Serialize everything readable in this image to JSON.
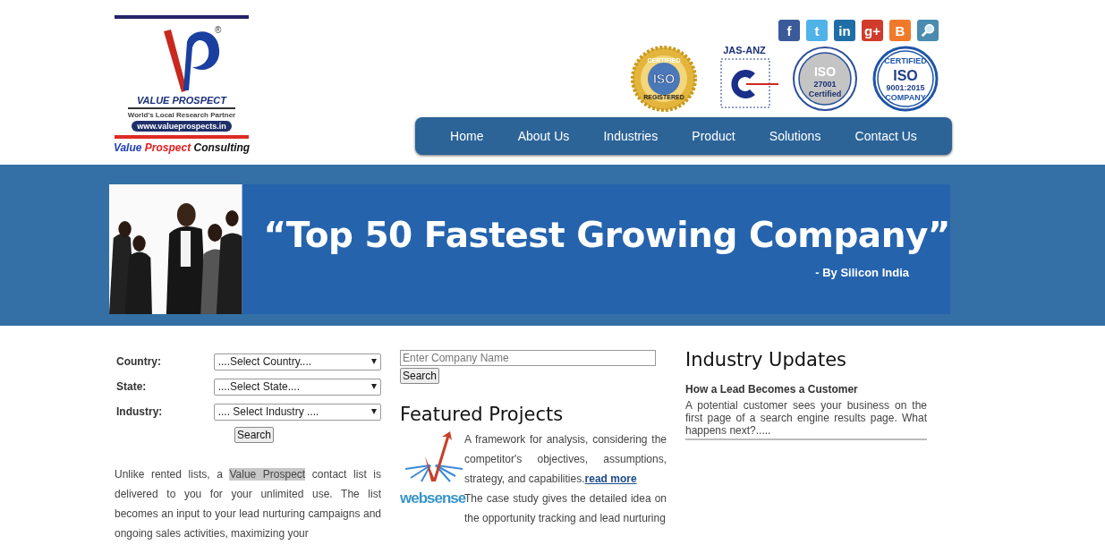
{
  "logo": {
    "registered": "®",
    "brand": "VALUE PROSPECT",
    "tagline": "World's Local Research Partner",
    "url": "www.valueprospects.in",
    "caption": [
      {
        "text": "Value",
        "color": "#1f3fb8"
      },
      {
        "text": "Prospect",
        "color": "#e02020"
      },
      {
        "text": "Consulting",
        "color": "#111111"
      }
    ]
  },
  "social_icons": [
    {
      "kind": "facebook",
      "glyph": "f"
    },
    {
      "kind": "twitter",
      "glyph": "t"
    },
    {
      "kind": "linkedin",
      "glyph": "in"
    },
    {
      "kind": "googleplus",
      "glyph": "g+"
    },
    {
      "kind": "blogger",
      "glyph": "B"
    },
    {
      "kind": "search"
    }
  ],
  "badges": [
    {
      "kind": "seal",
      "texts": [
        "CERTIFIED",
        "ISO",
        "REGISTERED"
      ]
    },
    {
      "kind": "jasanz",
      "texts": [
        "JAS-ANZ"
      ]
    },
    {
      "kind": "ring",
      "texts": [
        "ISO",
        "27001",
        "Certified"
      ]
    },
    {
      "kind": "stamp",
      "texts": [
        "CERTIFIED",
        "ISO",
        "9001:2015",
        "COMPANY"
      ]
    }
  ],
  "nav": [
    {
      "label": "Home"
    },
    {
      "label": "About Us"
    },
    {
      "label": "Industries"
    },
    {
      "label": "Product"
    },
    {
      "label": "Solutions"
    },
    {
      "label": "Contact Us"
    }
  ],
  "banner": {
    "headline": "“Top 50 Fastest Growing Company”",
    "byline": "- By Silicon India"
  },
  "search_form": {
    "fields": [
      {
        "label": "Country:",
        "value": "....Select Country...."
      },
      {
        "label": "State:",
        "value": "....Select State...."
      },
      {
        "label": "Industry:",
        "value": ".... Select Industry ...."
      }
    ],
    "button": "Search"
  },
  "intro": {
    "before": "Unlike rented lists, a ",
    "highlight": "Value Prospect",
    "after": " contact list is delivered to you for your unlimited use. The list becomes an input to your lead nurturing campaigns and ongoing sales activities, maximizing your"
  },
  "company_search": {
    "placeholder": "Enter Company Name",
    "button": "Search"
  },
  "featured": {
    "title": "Featured Projects",
    "items": [
      {
        "kind": "arrows",
        "text": "A framework for analysis, considering the competitor's objectives, assumptions, strategy, and capabilities.",
        "link": "read more"
      },
      {
        "kind": "websense",
        "logo_text": "websense",
        "text": "The case study gives the detailed idea on the opportunity tracking and lead nurturing"
      }
    ]
  },
  "updates": {
    "title": "Industry Updates",
    "items": [
      {
        "title": "How a Lead Becomes a Customer",
        "summary": "A potential customer sees your business on the first page of a search engine results page. What happens next?....."
      }
    ]
  }
}
